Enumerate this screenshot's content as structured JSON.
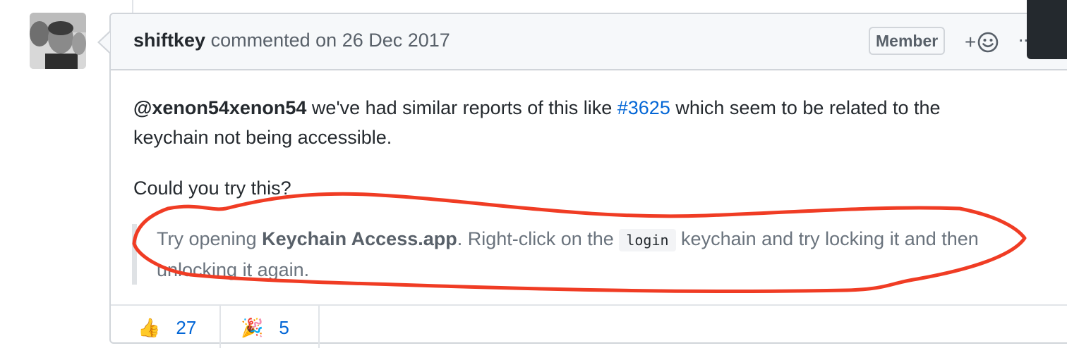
{
  "comment": {
    "author": "shiftkey",
    "action": "commented on",
    "date": "26 Dec 2017",
    "badge": "Member",
    "add_reaction_plus": "+",
    "more_label": "···",
    "mention": "@xenon54xenon54",
    "text_before_link": " we've had similar reports of this like ",
    "issue_link": "#3625",
    "text_after_link": " which seem to be related to the keychain not being accessible.",
    "question": "Could you try this?",
    "quote": {
      "prefix": "Try opening ",
      "app_name": "Keychain Access.app",
      "middle": ". Right-click on the ",
      "code": "login",
      "suffix": " keychain and try locking it and then unlocking it again."
    }
  },
  "reactions": [
    {
      "icon": "thumbs-up",
      "glyph": "👍",
      "count": "27"
    },
    {
      "icon": "party-popper",
      "glyph": "🎉",
      "count": "5"
    }
  ],
  "annotation_color": "#f03c24"
}
